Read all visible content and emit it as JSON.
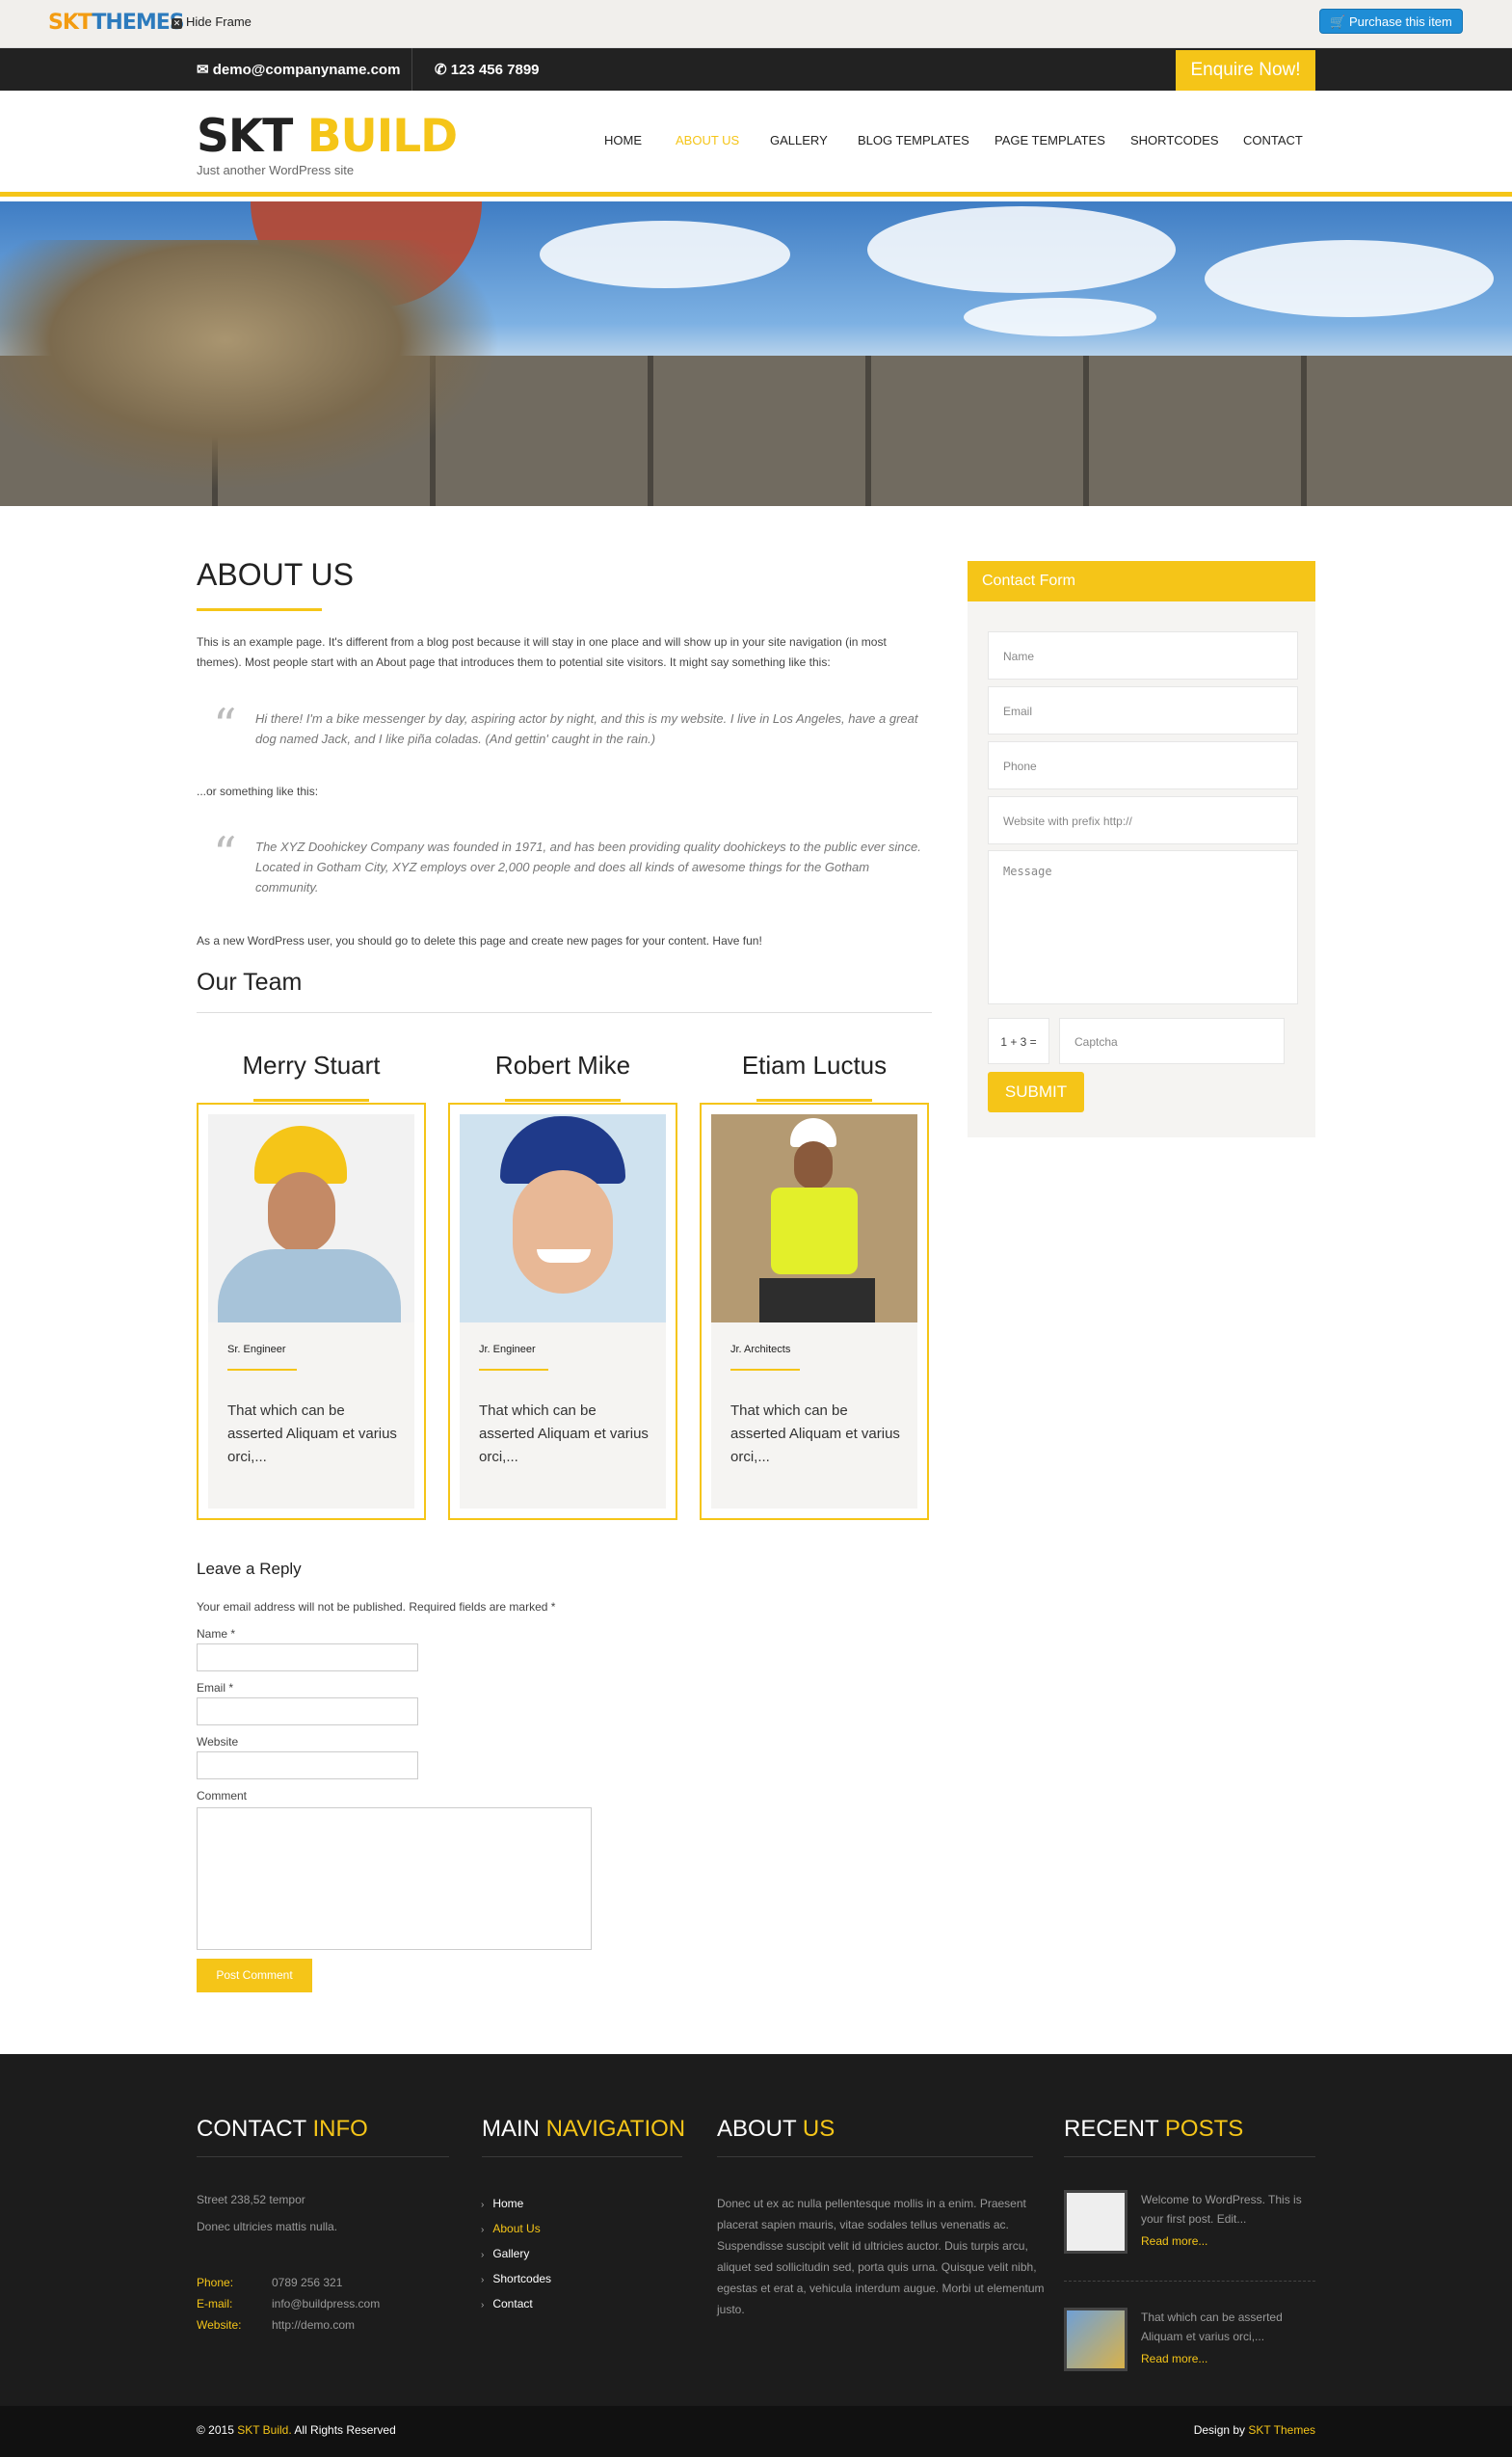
{
  "frame": {
    "logo_a": "SKT",
    "logo_b": "THEMES",
    "hide_frame": "Hide Frame",
    "purchase": "Purchase this item"
  },
  "topbar": {
    "email": "demo@companyname.com",
    "phone": "123 456 7899",
    "enquire": "Enquire Now!"
  },
  "header": {
    "title_a": "SKT",
    "title_b": "BUILD",
    "tagline": "Just another WordPress site",
    "nav": [
      "HOME",
      "ABOUT US",
      "GALLERY",
      "BLOG TEMPLATES",
      "PAGE TEMPLATES",
      "SHORTCODES",
      "CONTACT"
    ]
  },
  "main": {
    "title": "ABOUT US",
    "intro": "This is an example page. It's different from a blog post because it will stay in one place and will show up in your site navigation (in most themes). Most people start with an About page that introduces them to potential site visitors. It might say something like this:",
    "quote1": "Hi there! I'm a bike messenger by day, aspiring actor by night, and this is my website. I live in Los Angeles, have a great dog named Jack, and I like piña coladas. (And gettin' caught in the rain.)",
    "or_like": "...or something like this:",
    "quote2": "The XYZ Doohickey Company was founded in 1971, and has been providing quality doohickeys to the public ever since. Located in Gotham City, XYZ employs over 2,000 people and does all kinds of awesome things for the Gotham community.",
    "outro": "As a new WordPress user, you should go to delete this page and create new pages for your content. Have fun!",
    "team_title": "Our Team",
    "team": [
      {
        "name": "Merry Stuart",
        "role": "Sr. Engineer",
        "bio": "That which can be asserted Aliquam et varius orci,..."
      },
      {
        "name": "Robert Mike",
        "role": "Jr. Engineer",
        "bio": "That which can be asserted Aliquam et varius orci,..."
      },
      {
        "name": "Etiam Luctus",
        "role": "Jr. Architects",
        "bio": "That which can be asserted Aliquam et varius orci,..."
      }
    ]
  },
  "reply": {
    "title": "Leave a Reply",
    "note": "Your email address will not be published. Required fields are marked *",
    "name": "Name *",
    "email": "Email *",
    "website": "Website",
    "comment": "Comment",
    "button": "Post Comment"
  },
  "contact_form": {
    "title": "Contact Form",
    "name": "Name",
    "email": "Email",
    "phone": "Phone",
    "website": "Website with prefix http://",
    "message": "Message",
    "captcha_q": "1 + 3 =",
    "captcha": "Captcha",
    "submit": "SUBMIT"
  },
  "footer": {
    "contact_a": "CONTACT",
    "contact_b": "INFO",
    "street": "Street 238,52 tempor",
    "street2": "Donec ultricies mattis nulla.",
    "phone_lbl": "Phone:",
    "phone": "0789 256 321",
    "email_lbl": "E-mail:",
    "email": "info@buildpress.com",
    "website_lbl": "Website:",
    "website": "http://demo.com",
    "nav_a": "MAIN",
    "nav_b": "NAVIGATION",
    "nav": [
      "Home",
      "About Us",
      "Gallery",
      "Shortcodes",
      "Contact"
    ],
    "about_a": "ABOUT",
    "about_b": "US",
    "about_text": "Donec ut ex ac nulla pellentesque mollis in a enim. Praesent placerat sapien mauris, vitae sodales tellus venenatis ac. Suspendisse suscipit velit id ultricies auctor. Duis turpis arcu, aliquet sed sollicitudin sed, porta quis urna. Quisque velit nibh, egestas et erat a, vehicula interdum augue. Morbi ut elementum justo.",
    "recent_a": "RECENT",
    "recent_b": "POSTS",
    "posts": [
      {
        "text": "Welcome to WordPress. This is your first post. Edit...",
        "more": "Read more..."
      },
      {
        "text": "That which can be asserted Aliquam et varius orci,...",
        "more": "Read more..."
      }
    ]
  },
  "copyright": {
    "left_a": "© 2015",
    "left_b": "SKT Build.",
    "left_c": "All Rights Reserved",
    "right_a": "Design by",
    "right_b": "SKT Themes"
  }
}
